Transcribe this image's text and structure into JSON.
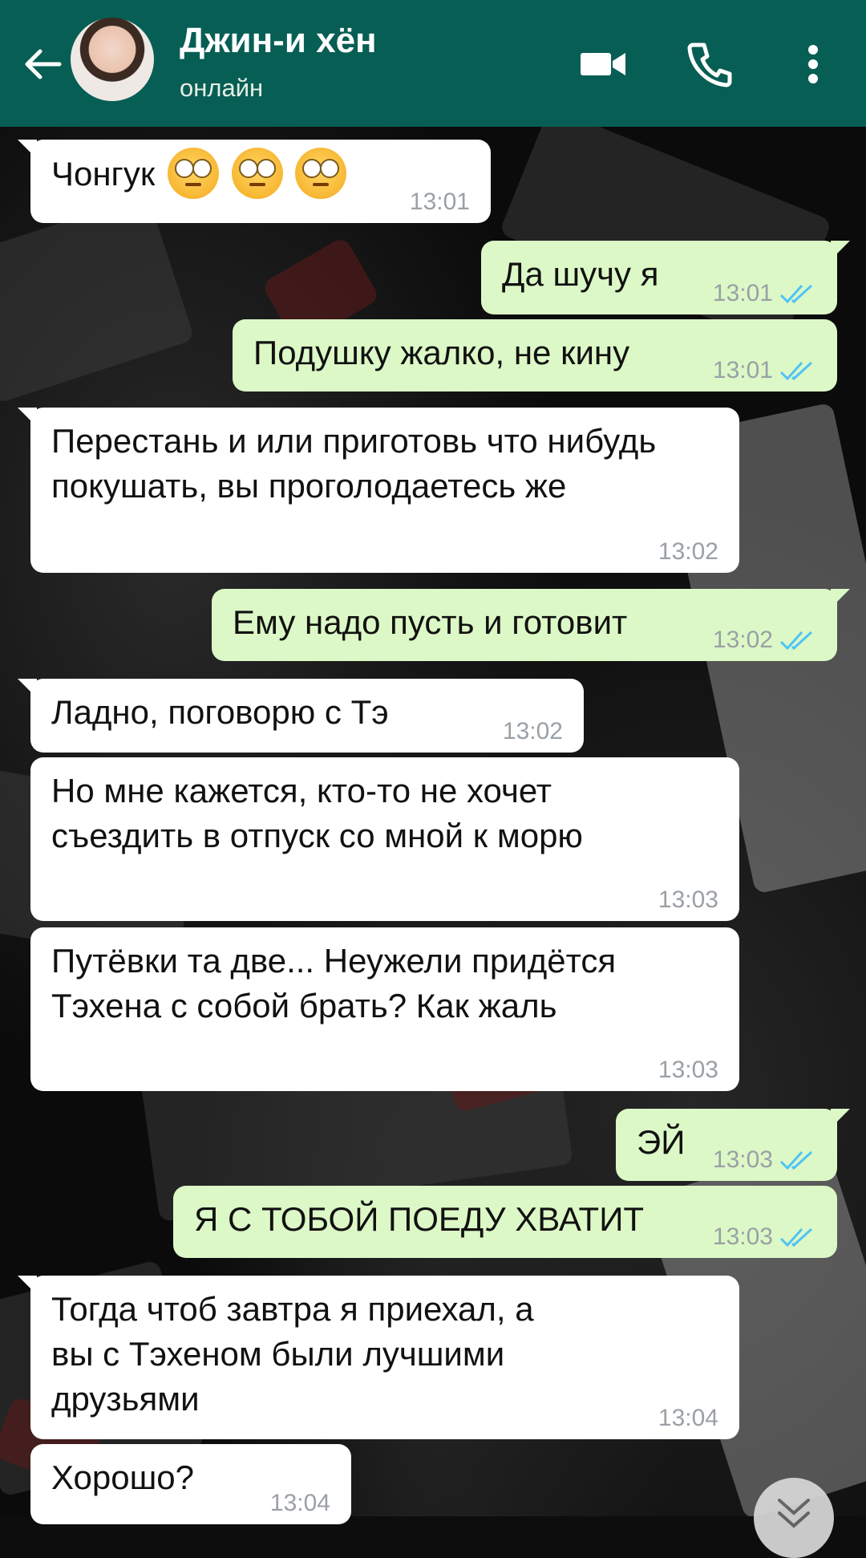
{
  "header": {
    "contact_name": "Джин-и хён",
    "status": "онлайн",
    "background": "#075e54"
  },
  "icons": {
    "back": "arrow-left-icon",
    "video": "video-camera-icon",
    "call": "phone-icon",
    "menu": "more-vert-icon",
    "scroll_down": "chevron-double-down-icon",
    "read_receipt": "double-check-icon",
    "emoji": "face-with-rolling-eyes-emoji"
  },
  "colors": {
    "incoming_bubble": "#ffffff",
    "outgoing_bubble": "#dcf8c6",
    "tick_blue": "#4fc3f7",
    "time_gray": "#9aa0a6"
  },
  "messages": [
    {
      "from": "them",
      "text": "Чонгук",
      "emoji_count": 3,
      "time": "13:01"
    },
    {
      "from": "me",
      "text": "Да шучу я",
      "time": "13:01",
      "read": true
    },
    {
      "from": "me",
      "text": "Подушку жалко, не кину",
      "time": "13:01",
      "read": true
    },
    {
      "from": "them",
      "text": "Перестань и или приготовь что нибудь покушать, вы проголодаетесь же",
      "time": "13:02"
    },
    {
      "from": "me",
      "text": "Ему надо пусть и готовит",
      "time": "13:02",
      "read": true
    },
    {
      "from": "them",
      "text": "Ладно, поговорю с Тэ",
      "time": "13:02"
    },
    {
      "from": "them",
      "text": "Но мне кажется, кто-то не хочет съездить в отпуск со мной к морю",
      "time": "13:03"
    },
    {
      "from": "them",
      "text": "Путёвки та две... Неужели придётся Тэхена с собой брать? Как жаль",
      "time": "13:03"
    },
    {
      "from": "me",
      "text": "ЭЙ",
      "time": "13:03",
      "read": true
    },
    {
      "from": "me",
      "text": "Я С ТОБОЙ ПОЕДУ ХВАТИТ",
      "time": "13:03",
      "read": true
    },
    {
      "from": "them",
      "text": "Тогда чтоб завтра я приехал, а вы с Тэхеном были лучшими друзьями",
      "time": "13:04"
    },
    {
      "from": "them",
      "text": "Хорошо?",
      "time": "13:04"
    }
  ]
}
